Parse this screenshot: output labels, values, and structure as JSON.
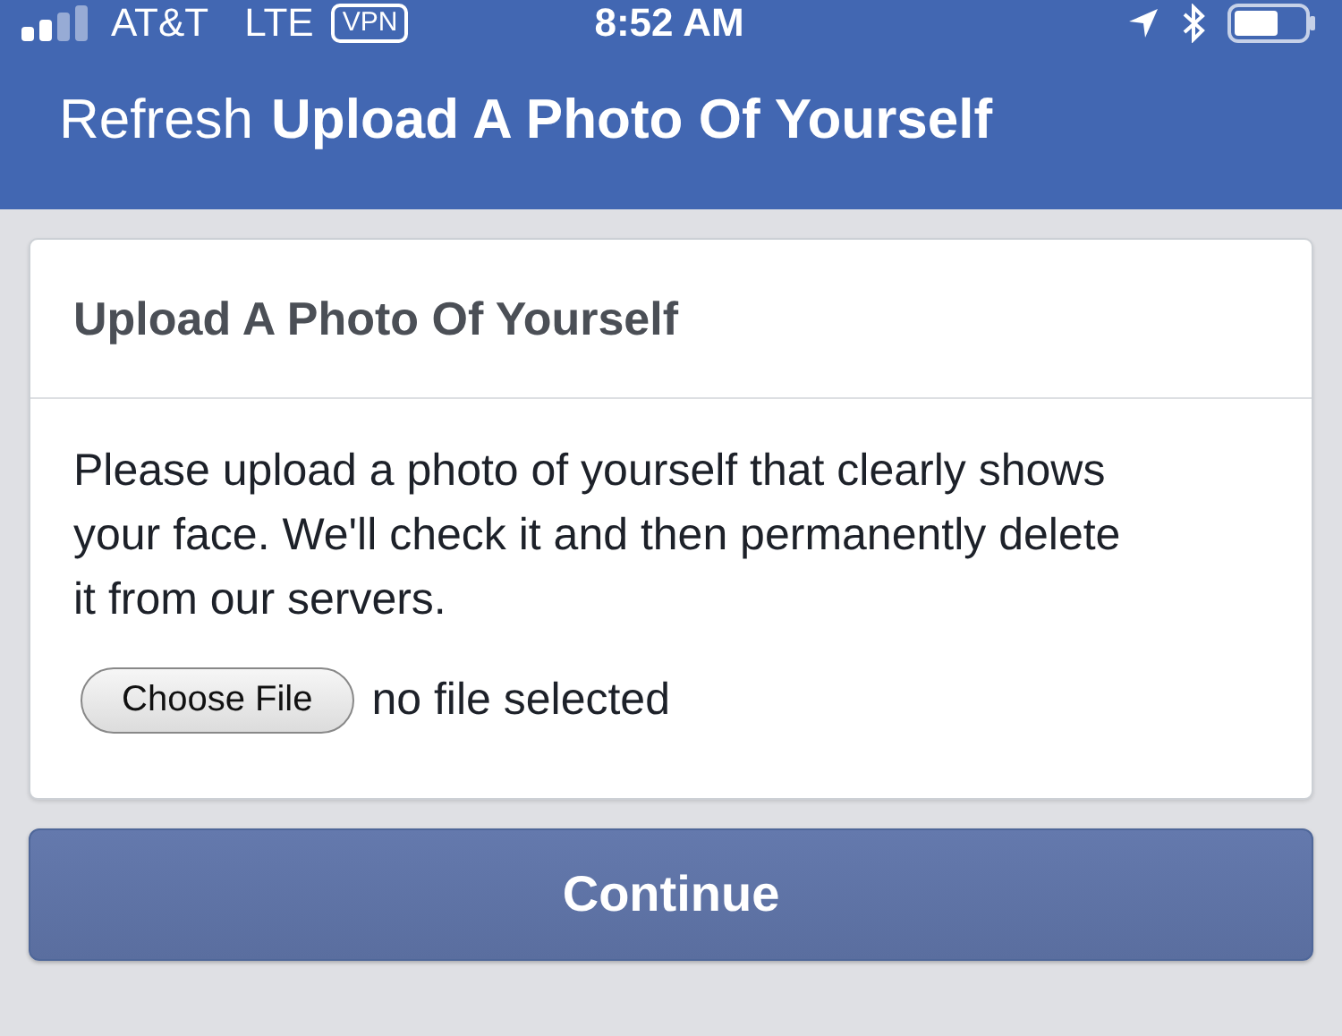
{
  "status_bar": {
    "carrier": "AT&T",
    "network": "LTE",
    "vpn": "VPN",
    "time": "8:52 AM"
  },
  "nav_bar": {
    "action": "Refresh",
    "title": "Upload A Photo Of Yourself"
  },
  "card": {
    "title": "Upload A Photo Of Yourself",
    "body": "Please upload a photo of yourself that clearly shows your face. We'll check it and then permanently delete it from our servers.",
    "file_button": "Choose File",
    "file_status": "no file selected"
  },
  "primary_button": "Continue"
}
